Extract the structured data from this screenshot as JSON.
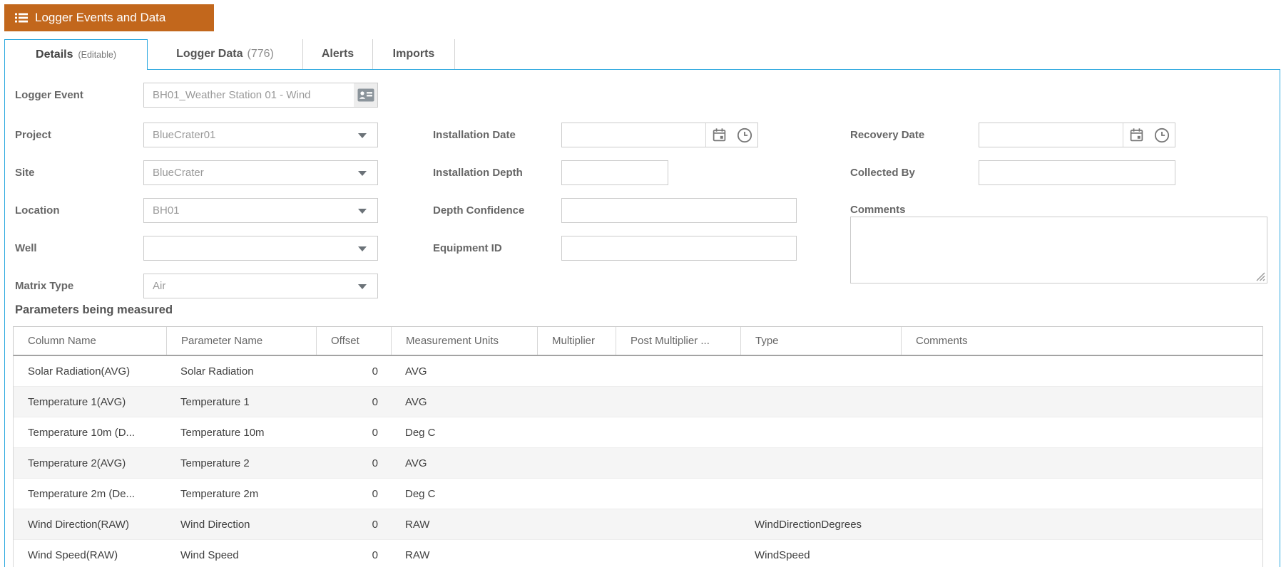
{
  "header": {
    "title": "Logger Events and Data"
  },
  "tabs": [
    {
      "label": "Details",
      "suffix": "(Editable)",
      "active": true
    },
    {
      "label": "Logger Data",
      "suffix": "(776)",
      "active": false
    },
    {
      "label": "Alerts",
      "suffix": "",
      "active": false
    },
    {
      "label": "Imports",
      "suffix": "",
      "active": false
    }
  ],
  "form": {
    "logger_event": {
      "label": "Logger Event",
      "value": "BH01_Weather Station 01 - Wind"
    },
    "project": {
      "label": "Project",
      "value": "BlueCrater01"
    },
    "site": {
      "label": "Site",
      "value": "BlueCrater"
    },
    "location": {
      "label": "Location",
      "value": "BH01"
    },
    "well": {
      "label": "Well",
      "value": ""
    },
    "matrix_type": {
      "label": "Matrix Type",
      "value": "Air"
    },
    "installation_date": {
      "label": "Installation Date",
      "value": ""
    },
    "installation_depth": {
      "label": "Installation Depth",
      "value": ""
    },
    "depth_confidence": {
      "label": "Depth Confidence",
      "value": ""
    },
    "equipment_id": {
      "label": "Equipment ID",
      "value": ""
    },
    "recovery_date": {
      "label": "Recovery Date",
      "value": ""
    },
    "collected_by": {
      "label": "Collected By",
      "value": ""
    },
    "comments": {
      "label": "Comments",
      "value": ""
    }
  },
  "parameters": {
    "title": "Parameters being measured",
    "columns": [
      "Column Name",
      "Parameter Name",
      "Offset",
      "Measurement Units",
      "Multiplier",
      "Post Multiplier ...",
      "Type",
      "Comments"
    ],
    "rows": [
      [
        "Solar Radiation(AVG)",
        "Solar Radiation",
        "0",
        "AVG",
        "",
        "",
        "",
        ""
      ],
      [
        "Temperature 1(AVG)",
        "Temperature 1",
        "0",
        "AVG",
        "",
        "",
        "",
        ""
      ],
      [
        "Temperature 10m (D...",
        "Temperature 10m",
        "0",
        "Deg C",
        "",
        "",
        "",
        ""
      ],
      [
        "Temperature 2(AVG)",
        "Temperature 2",
        "0",
        "AVG",
        "",
        "",
        "",
        ""
      ],
      [
        "Temperature 2m (De...",
        "Temperature 2m",
        "0",
        "Deg C",
        "",
        "",
        "",
        ""
      ],
      [
        "Wind Direction(RAW)",
        "Wind Direction",
        "0",
        "RAW",
        "",
        "",
        "WindDirectionDegrees",
        ""
      ],
      [
        "Wind Speed(RAW)",
        "Wind Speed",
        "0",
        "RAW",
        "",
        "",
        "WindSpeed",
        ""
      ]
    ]
  },
  "icons": {
    "header": "list-icon",
    "logger_event": "contact-card-icon",
    "date_fields": [
      "calendar-icon",
      "clock-icon"
    ],
    "dropdown": "caret-down-icon",
    "comments": "resize-handle-icon"
  },
  "colors": {
    "accent_orange": "#C2671C",
    "tab_blue": "#2CA8DF",
    "alt_row": "#F5F5F5",
    "field_border": "#CBCBCB",
    "label_text": "#666666",
    "value_text": "#999999"
  }
}
